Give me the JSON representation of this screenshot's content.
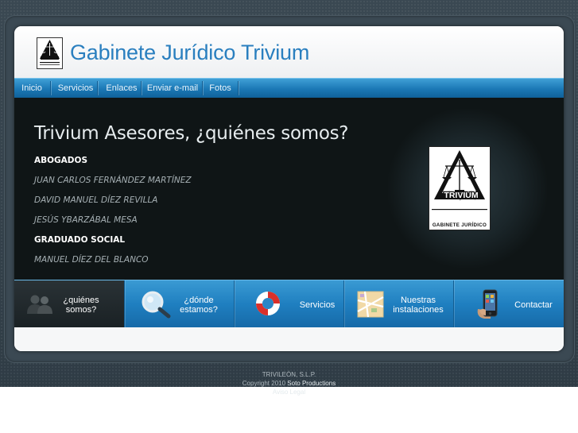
{
  "header": {
    "site_title": "Gabinete Jurídico Trivium"
  },
  "nav": {
    "items": [
      {
        "label": "Inicio"
      },
      {
        "label": "Servicios"
      },
      {
        "label": "Enlaces"
      },
      {
        "label": "Enviar e-mail"
      },
      {
        "label": "Fotos"
      }
    ]
  },
  "hero": {
    "title": "Trivium Asesores, ¿quiénes somos?",
    "sections": [
      {
        "heading": "ABOGADOS",
        "names": [
          "JUAN CARLOS FERNÁNDEZ MARTÍNEZ",
          "DAVID MANUEL DÍEZ REVILLA",
          "JESÚS YBARZÁBAL MESA"
        ]
      },
      {
        "heading": "GRADUADO SOCIAL",
        "names": [
          "MANUEL DÍEZ DEL BLANCO"
        ]
      }
    ],
    "emblem": {
      "word": "TRIVIUM",
      "caption": "GABINETE JURÍDICO"
    }
  },
  "features": [
    {
      "line1": "¿quiénes",
      "line2": "somos?",
      "icon": "people-icon"
    },
    {
      "line1": "¿dónde",
      "line2": "estamos?",
      "icon": "magnifier-icon"
    },
    {
      "line1": "Servicios",
      "line2": "",
      "icon": "lifebuoy-icon"
    },
    {
      "line1": "Nuestras",
      "line2": "instalaciones",
      "icon": "map-icon"
    },
    {
      "line1": "Contactar",
      "line2": "",
      "icon": "phone-icon"
    }
  ],
  "footer": {
    "company": "TRIVILEÓN, S.L.P.",
    "copyright": "Copyright 2010",
    "credit": "Soto Productions",
    "legal": "Aviso Legal"
  },
  "colors": {
    "title_blue": "#2a7fbf",
    "nav_blue": "#1b78b5",
    "hero_bg": "#0f1516",
    "page_bg": "#33414a"
  }
}
